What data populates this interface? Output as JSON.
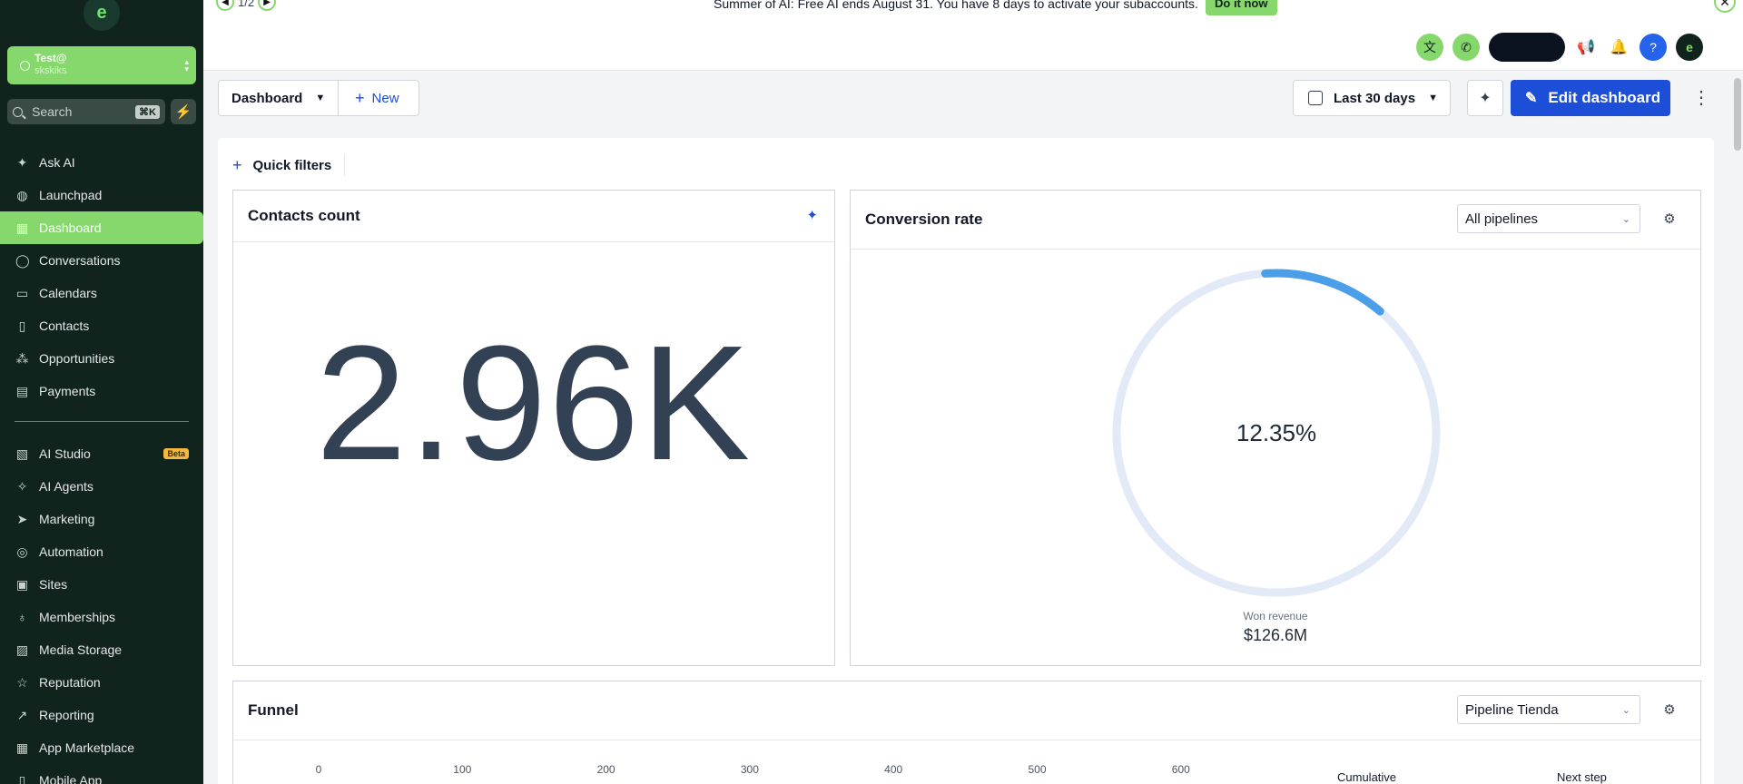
{
  "sidebar": {
    "logo_letter": "e",
    "account": {
      "name": "Test@",
      "sub": "skskiks"
    },
    "search": {
      "placeholder": "Search",
      "shortcut": "⌘K"
    },
    "items_top": [
      {
        "label": "Ask AI",
        "icon": "sparkle-icon"
      },
      {
        "label": "Launchpad",
        "icon": "rocket-icon"
      },
      {
        "label": "Dashboard",
        "icon": "grid-icon",
        "active": true
      },
      {
        "label": "Conversations",
        "icon": "chat-icon"
      },
      {
        "label": "Calendars",
        "icon": "calendar-icon"
      },
      {
        "label": "Contacts",
        "icon": "contacts-icon"
      },
      {
        "label": "Opportunities",
        "icon": "opportunities-icon"
      },
      {
        "label": "Payments",
        "icon": "receipt-icon"
      }
    ],
    "items_bottom": [
      {
        "label": "AI Studio",
        "icon": "ai-studio-icon",
        "badge": "Beta"
      },
      {
        "label": "AI Agents",
        "icon": "ai-agents-icon"
      },
      {
        "label": "Marketing",
        "icon": "send-icon"
      },
      {
        "label": "Automation",
        "icon": "automation-icon"
      },
      {
        "label": "Sites",
        "icon": "sites-icon"
      },
      {
        "label": "Memberships",
        "icon": "award-icon"
      },
      {
        "label": "Media Storage",
        "icon": "image-icon"
      },
      {
        "label": "Reputation",
        "icon": "star-icon"
      },
      {
        "label": "Reporting",
        "icon": "trending-icon"
      },
      {
        "label": "App Marketplace",
        "icon": "apps-icon"
      },
      {
        "label": "Mobile App",
        "icon": "mobile-icon"
      }
    ]
  },
  "topbar": {
    "pager": "1/2",
    "announcement": "Summer of AI: Free AI ends August 31. You have 8 days to activate your subaccounts.",
    "cta": "Do it now"
  },
  "toolbar": {
    "dashboard_label": "Dashboard",
    "new_label": "New",
    "date_range": "Last 30 days",
    "edit_label": "Edit dashboard"
  },
  "quick_filters_label": "Quick filters",
  "contacts_card": {
    "title": "Contacts count",
    "value": "2.96K"
  },
  "conversion_card": {
    "title": "Conversion rate",
    "pipeline": "All pipelines",
    "rate_text": "12.35%",
    "rate_fraction": 0.1235,
    "won_label": "Won revenue",
    "won_value": "$126.6M",
    "track_color": "#e3eaf7",
    "arc_color": "#4a9fe8"
  },
  "funnel_card": {
    "title": "Funnel",
    "pipeline": "Pipeline Tienda",
    "axis_ticks": [
      "0",
      "100",
      "200",
      "300",
      "400",
      "500",
      "600"
    ],
    "col_cumulative": "Cumulative",
    "col_next_step": "Next step"
  }
}
